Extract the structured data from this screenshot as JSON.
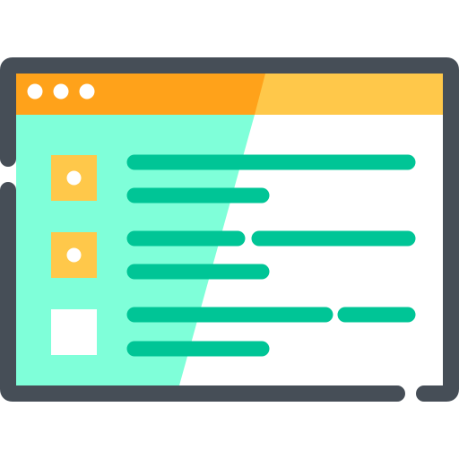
{
  "icon": {
    "name": "browser-window-checklist-icon",
    "colors": {
      "outline": "#464e57",
      "titlebar_left": "#ffa21a",
      "titlebar_right": "#ffc84a",
      "panel_left": "#7fffd9",
      "panel_right": "#ffffff",
      "accent_lines": "#00c596",
      "checkbox_checked": "#ffc84a",
      "checkbox_unchecked": "#ffffff",
      "dot": "#ffffff"
    },
    "titlebar": {
      "dot_count": 3
    },
    "list": {
      "rows": [
        {
          "checked": true
        },
        {
          "checked": true
        },
        {
          "checked": false
        }
      ]
    }
  }
}
